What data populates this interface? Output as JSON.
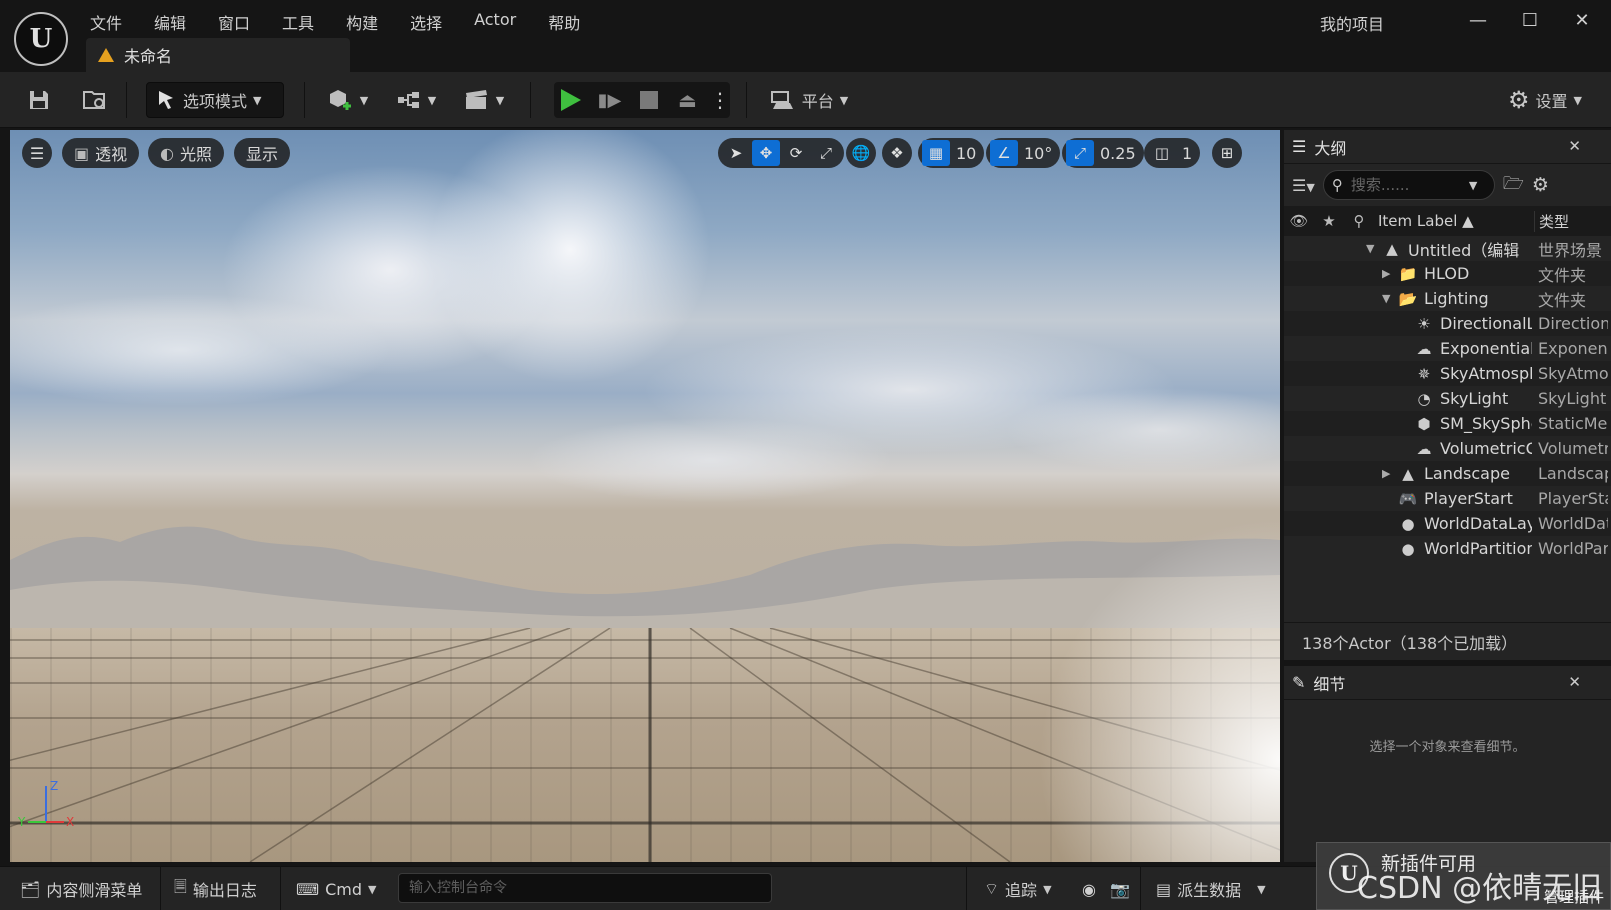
{
  "app": {
    "logo": "U",
    "menu": [
      "文件",
      "编辑",
      "窗口",
      "工具",
      "构建",
      "选择",
      "Actor",
      "帮助"
    ],
    "project_name": "我的项目",
    "document_tab": "未命名"
  },
  "toolbar": {
    "mode_label": "选项模式",
    "platform_label": "平台",
    "settings_label": "设置"
  },
  "viewport": {
    "menu_icon": "hamburger-icon",
    "perspective_label": "透视",
    "lighting_label": "光照",
    "show_label": "显示",
    "grid_snap": "10",
    "rotation_snap": "10°",
    "scale_snap": "0.25",
    "camera_speed": "1",
    "axis": {
      "z": "Z",
      "y": "Y",
      "x": "X"
    },
    "colors": {
      "active": "#0e6ed4",
      "axis_x": "#e03a3a",
      "axis_y": "#3ac83a",
      "axis_z": "#3a6ee0"
    }
  },
  "outliner": {
    "title": "大纲",
    "search_placeholder": "搜索......",
    "col_label": "Item Label",
    "col_type": "类型",
    "items": [
      {
        "label": "Untitled（编辑",
        "type": "世界场景",
        "depth": 0,
        "arrow": "▼",
        "icon": "level-icon"
      },
      {
        "label": "HLOD",
        "type": "文件夹",
        "depth": 1,
        "arrow": "▶",
        "icon": "folder-icon"
      },
      {
        "label": "Lighting",
        "type": "文件夹",
        "depth": 1,
        "arrow": "▼",
        "icon": "folder-open-icon"
      },
      {
        "label": "DirectionalLight",
        "type": "DirectionalLight",
        "depth": 2,
        "arrow": "",
        "icon": "sun-icon"
      },
      {
        "label": "ExponentialHeightFog",
        "type": "ExponentialHeightFog",
        "depth": 2,
        "arrow": "",
        "icon": "fog-icon"
      },
      {
        "label": "SkyAtmosphere",
        "type": "SkyAtmosphere",
        "depth": 2,
        "arrow": "",
        "icon": "sky-atmosphere-icon"
      },
      {
        "label": "SkyLight",
        "type": "SkyLight",
        "depth": 2,
        "arrow": "",
        "icon": "skylight-icon"
      },
      {
        "label": "SM_SkySphere",
        "type": "StaticMeshActor",
        "depth": 2,
        "arrow": "",
        "icon": "static-mesh-icon"
      },
      {
        "label": "VolumetricCloud",
        "type": "VolumetricCloud",
        "depth": 2,
        "arrow": "",
        "icon": "cloud-icon"
      },
      {
        "label": "Landscape",
        "type": "Landscape",
        "depth": 1,
        "arrow": "▶",
        "icon": "landscape-icon"
      },
      {
        "label": "PlayerStart",
        "type": "PlayerStart",
        "depth": 1,
        "arrow": "",
        "icon": "gamepad-icon"
      },
      {
        "label": "WorldDataLayers",
        "type": "WorldDataLayers",
        "depth": 1,
        "arrow": "",
        "icon": "world-icon"
      },
      {
        "label": "WorldPartitionMiniMap",
        "type": "WorldPartitionMiniMap",
        "depth": 1,
        "arrow": "",
        "icon": "world-icon"
      }
    ],
    "actor_count": "138个Actor（138个已加载）"
  },
  "details": {
    "title": "细节",
    "empty_text": "选择一个对象来查看细节。"
  },
  "bottombar": {
    "content_drawer": "内容侧滑菜单",
    "output_log": "输出日志",
    "cmd_label": "Cmd",
    "console_placeholder": "输入控制台命令",
    "trace_label": "追踪",
    "derived_data": "派生数据"
  },
  "plugin_toast": {
    "title": "新插件可用",
    "manage": "管理插件",
    "watermark": "CSDN @依晴无旧"
  }
}
